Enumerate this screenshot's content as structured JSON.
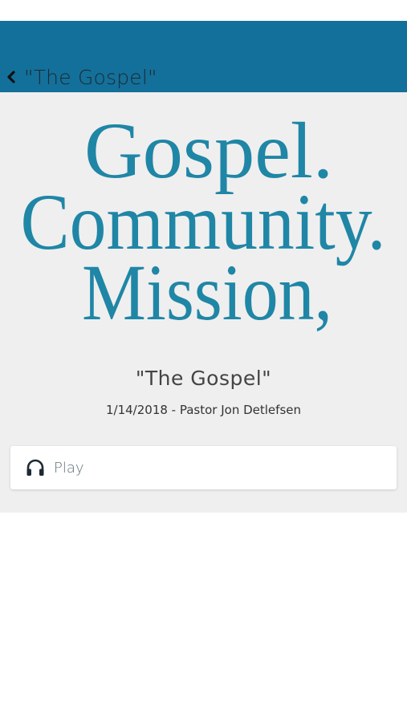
{
  "nav": {
    "title": "\"The Gospel\"",
    "back_icon": "chevron-left-icon",
    "bar_color": "#13709a"
  },
  "artwork": {
    "line1": "Gospel.",
    "line2": "Community.",
    "line3": "Mission,",
    "text_color": "#1f86a6"
  },
  "sermon": {
    "title": "\"The Gospel\"",
    "meta": "1/14/2018 - Pastor Jon Detlefsen"
  },
  "player": {
    "icon": "headphones-icon",
    "label": "Play"
  }
}
